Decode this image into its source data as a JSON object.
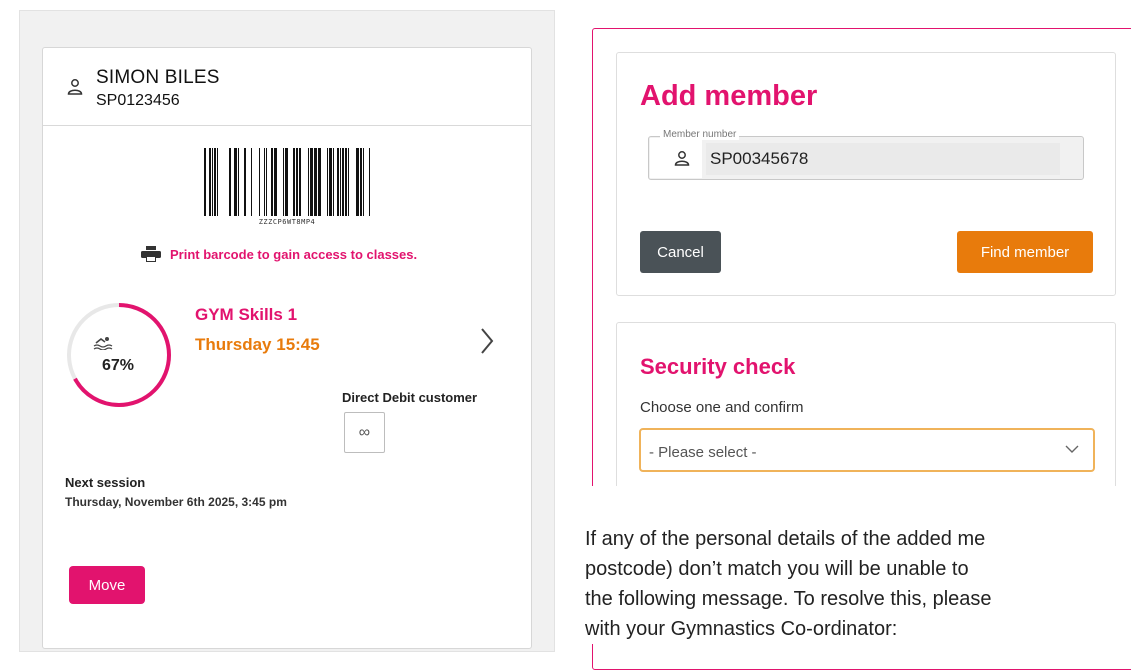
{
  "member_card": {
    "name": "SIMON BILES",
    "member_id": "SP0123456",
    "barcode_text": "ZZZCP6WT8MP4",
    "print_label": "Print barcode to gain access to classes.",
    "progress_percent": 67,
    "progress_label": "67%",
    "class_name": "GYM Skills 1",
    "class_time": "Thursday 15:45",
    "direct_debit_label": "Direct Debit customer",
    "direct_debit_icon": "∞",
    "next_session_label": "Next session",
    "next_session_value": "Thursday, November 6th 2025, 3:45 pm",
    "move_button": "Move"
  },
  "add_member": {
    "title": "Add member",
    "field_legend": "Member number",
    "field_value": "SP00345678",
    "cancel_button": "Cancel",
    "find_button": "Find member"
  },
  "security_check": {
    "title": "Security check",
    "choose_label": "Choose one and confirm",
    "select_value": "- Please select -"
  },
  "body_text": {
    "line1": "If any of the personal details of the added me",
    "line2": "postcode) don’t match you will be unable to",
    "line3": "the following message. To resolve this, please",
    "line4": "with your Gymnastics Co-ordinator:"
  },
  "colors": {
    "brand_pink": "#e2136e",
    "brand_orange": "#e87b0c",
    "cancel_grey": "#4a5257",
    "select_border": "#f0b35a"
  }
}
